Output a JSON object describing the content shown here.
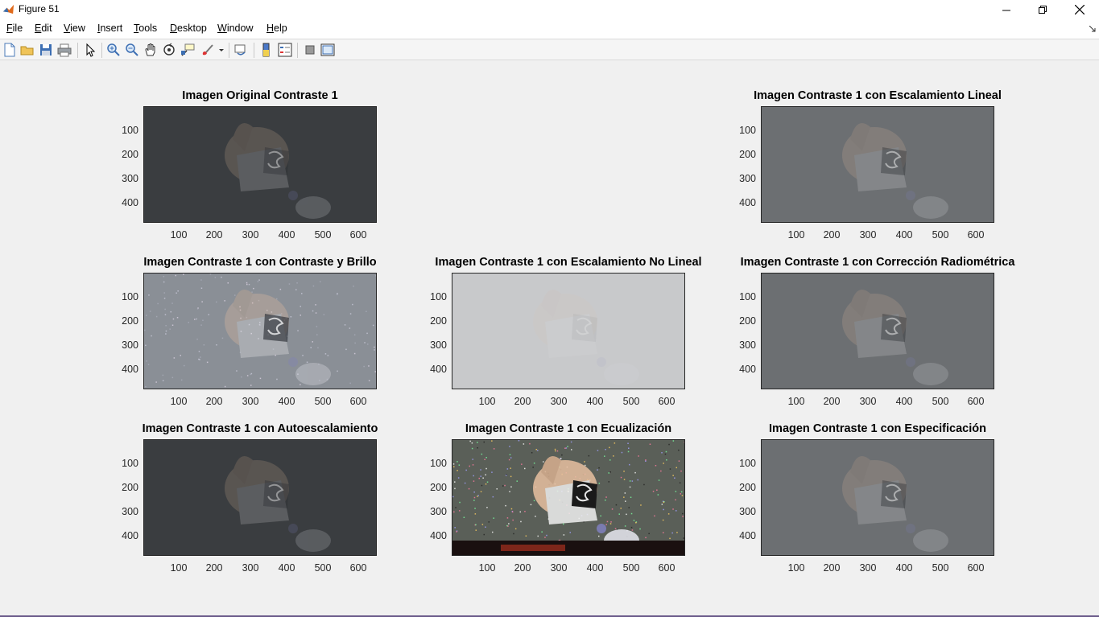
{
  "window": {
    "title": "Figure 51",
    "controls": [
      "minimize-icon",
      "restore-icon",
      "close-icon"
    ]
  },
  "menubar": {
    "items": [
      "File",
      "Edit",
      "View",
      "Insert",
      "Tools",
      "Desktop",
      "Window",
      "Help"
    ]
  },
  "toolbar": {
    "buttons": [
      "new-figure-icon",
      "open-icon",
      "save-icon",
      "print-icon",
      "edit-plot-icon",
      "zoom-in-icon",
      "zoom-out-icon",
      "pan-icon",
      "rotate-3d-icon",
      "data-cursor-icon",
      "brush-icon",
      "link-plot-icon",
      "colorbar-icon",
      "legend-icon",
      "hide-plot-tools-icon",
      "show-plot-tools-icon"
    ]
  },
  "axes_ticks": {
    "y": [
      "100",
      "200",
      "300",
      "400"
    ],
    "x": [
      "100",
      "200",
      "300",
      "400",
      "500",
      "600"
    ]
  },
  "subplots": [
    {
      "title": "Imagen Original Contraste 1",
      "style": "dark"
    },
    {
      "title": "Imagen Contraste 1 con Escalamiento Lineal",
      "style": "mid"
    },
    {
      "title": "Imagen Contraste 1 con Contraste y Brillo",
      "style": "noisy"
    },
    {
      "title": "Imagen Contraste 1 con Escalamiento No Lineal",
      "style": "light"
    },
    {
      "title": "Imagen Contraste 1 con Corrección Radiométrica",
      "style": "mid"
    },
    {
      "title": "Imagen Contraste 1 con Autoescalamiento",
      "style": "dark"
    },
    {
      "title": "Imagen Contraste 1 con Ecualización",
      "style": "equalized"
    },
    {
      "title": "Imagen Contraste 1 con Especificación",
      "style": "mid"
    }
  ],
  "colors": {
    "dark_bg": "#3a3d40",
    "mid_bg": "#6c6f72",
    "light_bg": "#c8c9cb",
    "noisy_bg": "#8a8f96",
    "eq_bg": "#5a5f58"
  }
}
